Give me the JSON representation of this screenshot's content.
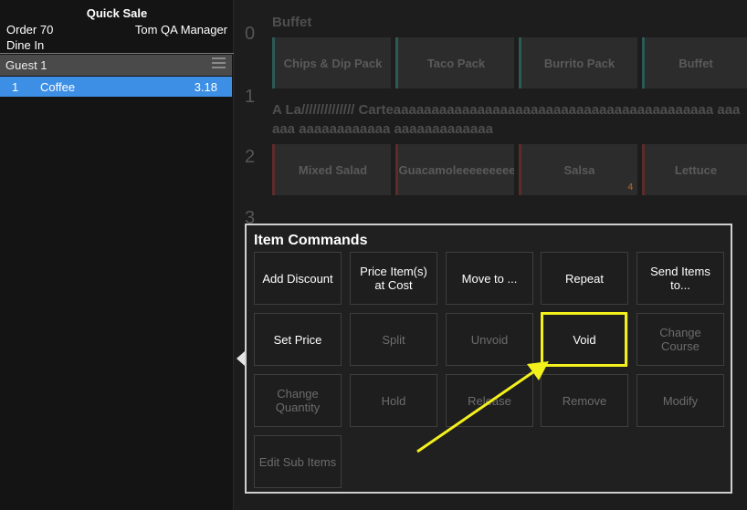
{
  "order_panel": {
    "title": "Quick Sale",
    "order_label": "Order 70",
    "user_name": "Tom QA Manager",
    "order_type": "Dine In",
    "guest_label": "Guest 1",
    "items": [
      {
        "qty": "1",
        "name": "Coffee",
        "price": "3.18"
      }
    ]
  },
  "menu": {
    "rows": [
      {
        "index": "0",
        "category": "Buffet",
        "items": [
          {
            "label": "Chips & Dip Pack",
            "color": "teal"
          },
          {
            "label": "Taco Pack",
            "color": "teal"
          },
          {
            "label": "Burrito Pack",
            "color": "teal"
          },
          {
            "label": "Buffet",
            "color": "teal"
          }
        ]
      },
      {
        "index": "1",
        "category": "A La////////////// Carteaaaaaaaaaaaaaaaaaaaaaaaaaaaaaaaaaaaaaaaaaa aaaaaa aaaaaaaaaaaa aaaaaaaaaaaaa",
        "items": []
      },
      {
        "index": "2",
        "category": "",
        "items": [
          {
            "label": "Mixed Salad",
            "color": "red"
          },
          {
            "label": "Guacamoleeeeeeeeee",
            "color": "red"
          },
          {
            "label": "Salsa",
            "color": "red",
            "count": "4"
          },
          {
            "label": "Lettuce",
            "color": "red"
          }
        ]
      },
      {
        "index": "3",
        "category": "",
        "items": []
      }
    ]
  },
  "item_commands": {
    "title": "Item Commands",
    "buttons": [
      {
        "label": "Add Discount",
        "enabled": true
      },
      {
        "label": "Price Item(s) at Cost",
        "enabled": true
      },
      {
        "label": "Move to ...",
        "enabled": true
      },
      {
        "label": "Repeat",
        "enabled": true
      },
      {
        "label": "Send Items to...",
        "enabled": true
      },
      {
        "label": "Set Price",
        "enabled": true
      },
      {
        "label": "Split",
        "enabled": false
      },
      {
        "label": "Unvoid",
        "enabled": false
      },
      {
        "label": "Void",
        "enabled": true
      },
      {
        "label": "Change Course",
        "enabled": false
      },
      {
        "label": "Change Quantity",
        "enabled": false
      },
      {
        "label": "Hold",
        "enabled": false
      },
      {
        "label": "Release",
        "enabled": false
      },
      {
        "label": "Remove",
        "enabled": false
      },
      {
        "label": "Modify",
        "enabled": false
      },
      {
        "label": "Edit Sub Items",
        "enabled": false
      }
    ]
  },
  "colors": {
    "selected_row": "#3d8fe6",
    "highlight": "#f4f01c",
    "teal_accent": "#2c5a55",
    "red_accent": "#5e2b2b"
  }
}
